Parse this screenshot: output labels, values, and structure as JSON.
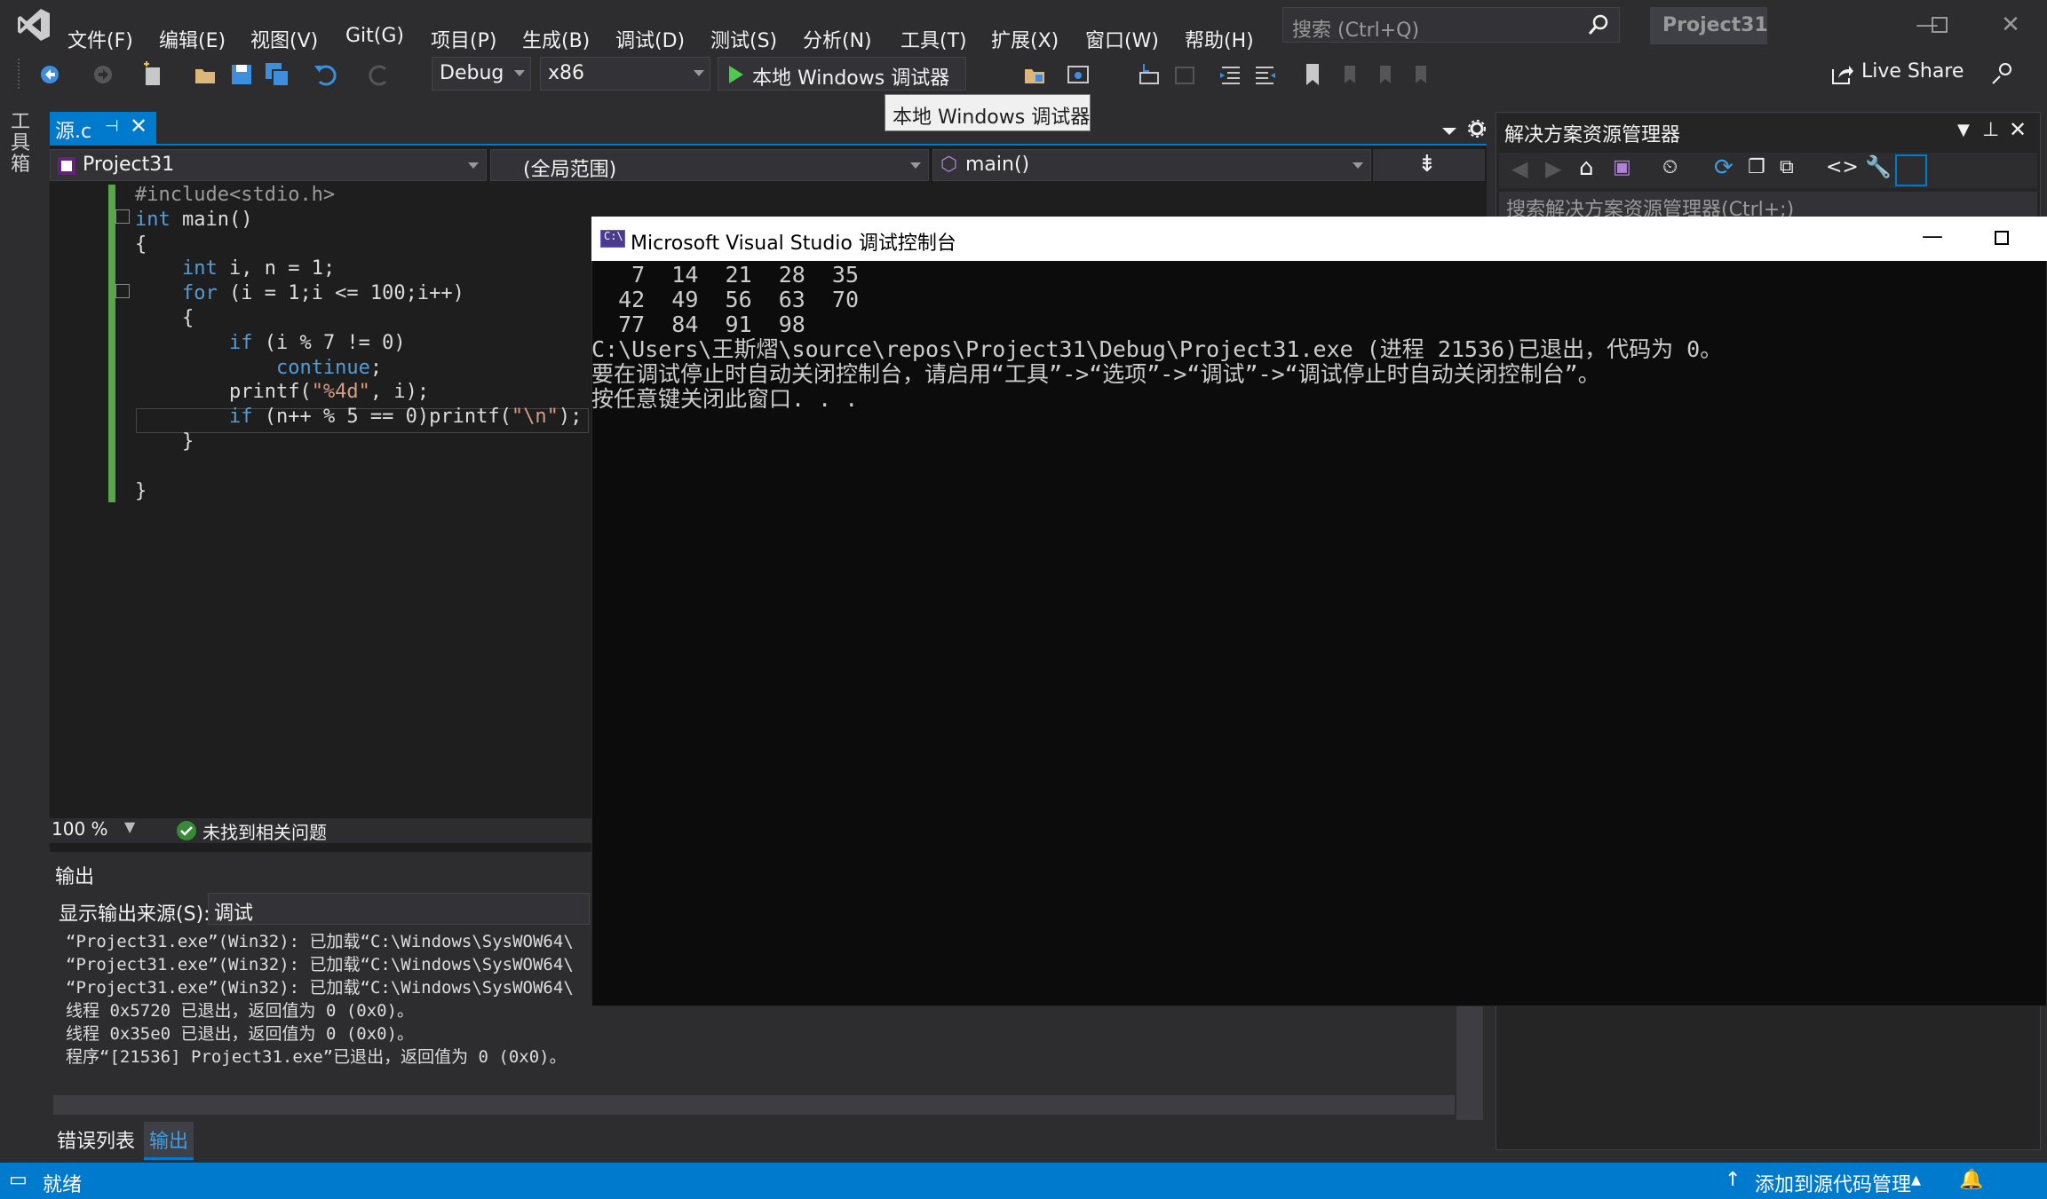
{
  "menu": {
    "items": [
      "文件(F)",
      "编辑(E)",
      "视图(V)",
      "Git(G)",
      "项目(P)",
      "生成(B)",
      "调试(D)",
      "测试(S)",
      "分析(N)",
      "工具(T)",
      "扩展(X)",
      "窗口(W)",
      "帮助(H)"
    ],
    "search_placeholder": "搜索 (Ctrl+Q)",
    "project_title": "Project31"
  },
  "toolbar": {
    "config": "Debug",
    "platform": "x86",
    "run_label": "本地 Windows 调试器",
    "tooltip": "本地 Windows 调试器",
    "live_share": "Live Share"
  },
  "toolbox_label": "工具箱",
  "editor": {
    "tab_label": "源.c",
    "project_combo": "Project31",
    "scope_combo": "(全局范围)",
    "function_combo": "main()",
    "zoom": "100 %",
    "issues": "未找到相关问题",
    "code": {
      "l1_pp": "#include",
      "l1_hdr": "<stdio.h>",
      "l2_kw": "int",
      "l2_rest": " main()",
      "l3": "{",
      "l4_kw": "int",
      "l4_rest": " i, n = 1;",
      "l5_kw": "for",
      "l5_rest": " (i = 1;i <= 100;i++)",
      "l6": "{",
      "l7_kw": "if",
      "l7_rest": " (i % 7 != 0)",
      "l8_kw": "continue",
      "l8_rest": ";",
      "l9_a": "printf(",
      "l9_str": "\"%4d\"",
      "l9_b": ", i);",
      "l10_kw": "if",
      "l10_a": " (n++ % 5 == 0)printf(",
      "l10_str": "\"\\n\"",
      "l10_b": ");",
      "l11": "}",
      "l12": "}"
    }
  },
  "output": {
    "title": "输出",
    "source_label": "显示输出来源(S):",
    "source_value": "调试",
    "lines": [
      "“Project31.exe”(Win32): 已加载“C:\\Windows\\SysWOW64\\",
      "“Project31.exe”(Win32): 已加载“C:\\Windows\\SysWOW64\\",
      "“Project31.exe”(Win32): 已加载“C:\\Windows\\SysWOW64\\",
      "线程 0x5720 已退出，返回值为 0 (0x0)。",
      "线程 0x35e0 已退出，返回值为 0 (0x0)。",
      "程序“[21536] Project31.exe”已退出，返回值为 0 (0x0)。"
    ],
    "tabs": [
      "错误列表",
      "输出"
    ]
  },
  "solution_explorer": {
    "title": "解决方案资源管理器",
    "search_placeholder": "搜索解决方案资源管理器(Ctrl+;)"
  },
  "console": {
    "icon_text": "C:\\",
    "title": "Microsoft Visual Studio 调试控制台",
    "lines": [
      "   7  14  21  28  35",
      "  42  49  56  63  70",
      "  77  84  91  98",
      "C:\\Users\\王斯熠\\source\\repos\\Project31\\Debug\\Project31.exe (进程 21536)已退出，代码为 0。",
      "要在调试停止时自动关闭控制台，请启用“工具”->“选项”->“调试”->“调试停止时自动关闭控制台”。",
      "按任意键关闭此窗口. . ."
    ]
  },
  "statusbar": {
    "ready": "就绪",
    "source_control": "添加到源代码管理"
  },
  "colors": {
    "accent": "#007acc",
    "background": "#2d2d30",
    "editor_bg": "#1e1e1e",
    "console_bg": "#0c0c0c",
    "keyword": "#569cd6",
    "string": "#d69d85"
  }
}
